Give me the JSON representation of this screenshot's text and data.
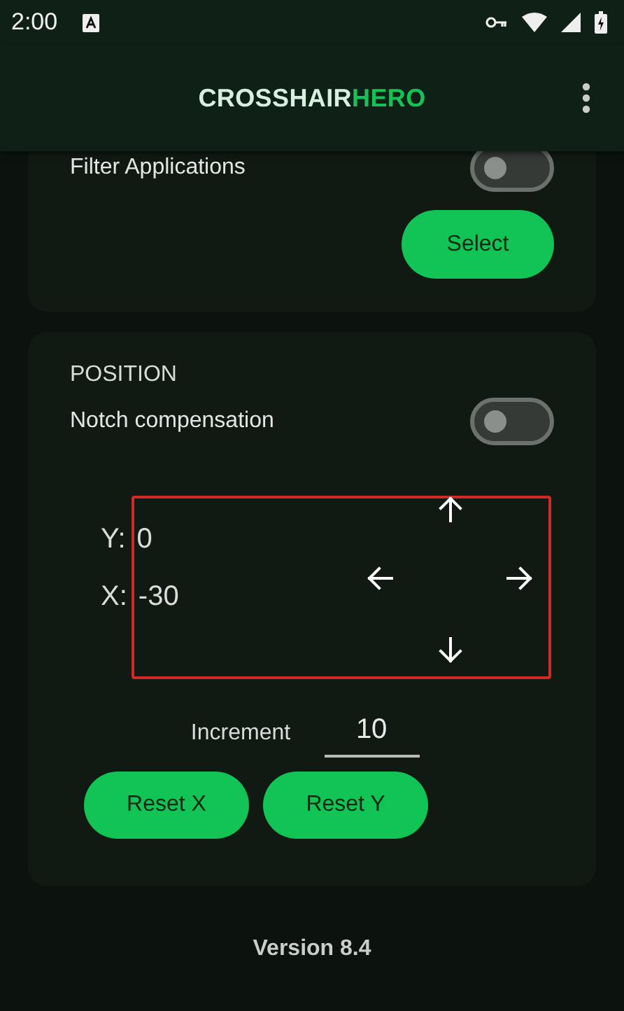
{
  "status_bar": {
    "time": "2:00"
  },
  "app_bar": {
    "title_parts": [
      {
        "text": "CROSSHAIR",
        "accent": false
      },
      {
        "text": "HERO",
        "accent": true
      }
    ]
  },
  "filter_card": {
    "label": "Filter Applications",
    "on": false,
    "button": "Select"
  },
  "position_card": {
    "heading": "POSITION",
    "notch_label": "Notch compensation",
    "notch_on": false,
    "y_label": "Y:",
    "y_value": "0",
    "x_label": "X:",
    "x_value": "-30",
    "increment_label": "Increment",
    "increment_value": "10",
    "buttons": [
      "Reset X",
      "Reset Y"
    ]
  },
  "version": "Version 8.4"
}
